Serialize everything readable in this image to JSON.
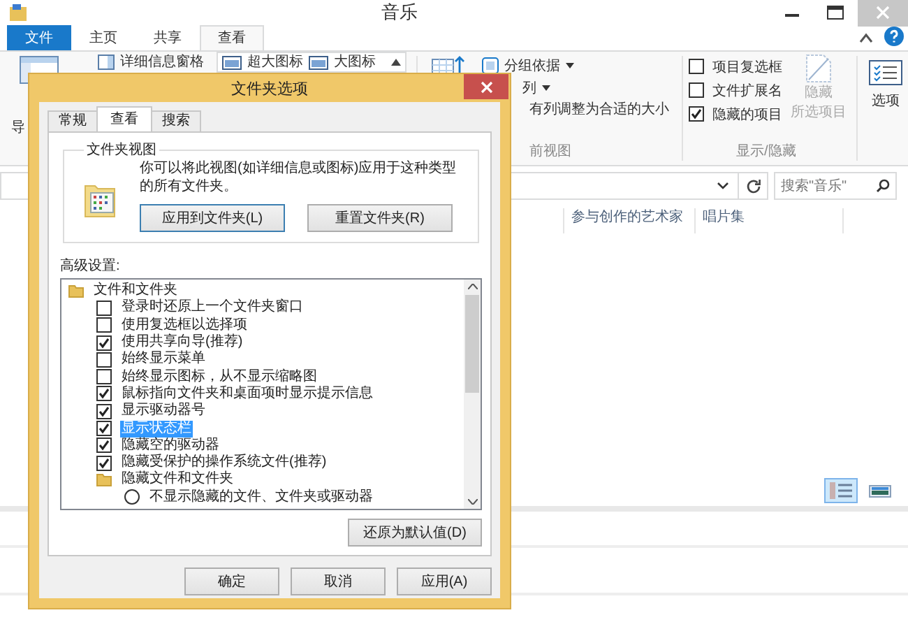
{
  "explorer": {
    "title": "音乐",
    "tabs": [
      {
        "label": "文件",
        "kind": "file",
        "selected": false
      },
      {
        "label": "主页",
        "kind": "tab",
        "selected": false
      },
      {
        "label": "共享",
        "kind": "tab",
        "selected": false
      },
      {
        "label": "查看",
        "kind": "tab",
        "selected": true
      }
    ],
    "ribbon": {
      "nav_fragment": "导",
      "pane_button": "详细信息窗格",
      "layouts": [
        "超大图标",
        "大图标"
      ],
      "group_by": "分组依据",
      "columns_menu": "列",
      "size_columns": "有列调整为合适的大小",
      "view_group_label": "前视图",
      "show_hide": {
        "checkboxes": [
          {
            "label": "项目复选框",
            "checked": false
          },
          {
            "label": "文件扩展名",
            "checked": false
          },
          {
            "label": "隐藏的项目",
            "checked": true
          }
        ],
        "hide_button": {
          "lines": [
            "隐藏",
            "所选项目"
          ],
          "disabled": true
        },
        "label": "显示/隐藏"
      },
      "options_button": "选项"
    },
    "search": {
      "placeholder": "搜索\"音乐\""
    },
    "columns": [
      "参与创作的艺术家",
      "唱片集"
    ],
    "view_buttons": [
      {
        "kind": "details",
        "selected": true
      },
      {
        "kind": "large_icons",
        "selected": false
      }
    ]
  },
  "dialog": {
    "title": "文件夹选项",
    "tabs": [
      {
        "label": "常规",
        "selected": false
      },
      {
        "label": "查看",
        "selected": true
      },
      {
        "label": "搜索",
        "selected": false
      }
    ],
    "folder_views": {
      "legend": "文件夹视图",
      "description": "你可以将此视图(如详细信息或图标)应用于这种类型的所有文件夹。",
      "buttons": [
        "应用到文件夹(L)",
        "重置文件夹(R)"
      ]
    },
    "advanced_label": "高级设置:",
    "advanced_items": [
      {
        "kind": "folder",
        "label": "文件和文件夹",
        "selected": false,
        "children": [
          {
            "kind": "checkbox",
            "label": "登录时还原上一个文件夹窗口",
            "checked": false,
            "selected": false
          },
          {
            "kind": "checkbox",
            "label": "使用复选框以选择项",
            "checked": false,
            "selected": false
          },
          {
            "kind": "checkbox",
            "label": "使用共享向导(推荐)",
            "checked": true,
            "selected": false
          },
          {
            "kind": "checkbox",
            "label": "始终显示菜单",
            "checked": false,
            "selected": false
          },
          {
            "kind": "checkbox",
            "label": "始终显示图标，从不显示缩略图",
            "checked": false,
            "selected": false
          },
          {
            "kind": "checkbox",
            "label": "鼠标指向文件夹和桌面项时显示提示信息",
            "checked": true,
            "selected": false
          },
          {
            "kind": "checkbox",
            "label": "显示驱动器号",
            "checked": true,
            "selected": false
          },
          {
            "kind": "checkbox",
            "label": "显示状态栏",
            "checked": true,
            "selected": true
          },
          {
            "kind": "checkbox",
            "label": "隐藏空的驱动器",
            "checked": true,
            "selected": false
          },
          {
            "kind": "checkbox",
            "label": "隐藏受保护的操作系统文件(推荐)",
            "checked": true,
            "selected": false
          },
          {
            "kind": "folder",
            "label": "隐藏文件和文件夹",
            "selected": false,
            "children": [
              {
                "kind": "radio",
                "label": "不显示隐藏的文件、文件夹或驱动器",
                "checked": false,
                "selected": false
              }
            ]
          }
        ]
      }
    ],
    "restore_button": "还原为默认值(D)",
    "buttons": [
      "确定",
      "取消",
      "应用(A)"
    ]
  }
}
